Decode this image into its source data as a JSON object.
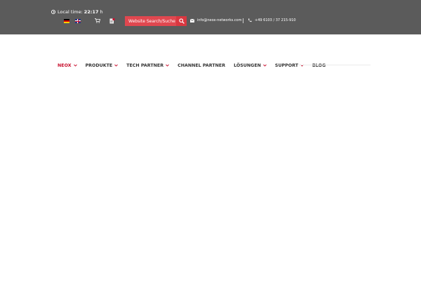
{
  "topbar": {
    "local_time_label": "Local time:",
    "local_time_value": "22:17",
    "local_time_unit": "h",
    "clock_icon": "clock-icon",
    "languages": [
      {
        "code": "de",
        "icon": "german-flag-icon"
      },
      {
        "code": "en",
        "icon": "uk-flag-icon"
      }
    ],
    "cart_icon": "cart-icon",
    "document_icon": "pdf-document-icon",
    "search": {
      "placeholder": "Website Search/Suche",
      "button_icon": "search-icon"
    },
    "email": "info@neox-networks.com",
    "phone": "+49 6103 / 37 215-910"
  },
  "nav": {
    "items": [
      {
        "label": "NEOX",
        "has_dropdown": true,
        "active": true
      },
      {
        "label": "PRODUKTE",
        "has_dropdown": true,
        "active": false
      },
      {
        "label": "TECH PARTNER",
        "has_dropdown": true,
        "active": false
      },
      {
        "label": "CHANNEL PARTNER",
        "has_dropdown": false,
        "active": false
      },
      {
        "label": "LÖSUNGEN",
        "has_dropdown": true,
        "active": false
      },
      {
        "label": "SUPPORT",
        "has_dropdown": true,
        "active": false
      },
      {
        "label": "BLOG",
        "has_dropdown": false,
        "active": false
      }
    ]
  },
  "colors": {
    "topbar_bg": "#5b5b5b",
    "search_bg": "#e0474f",
    "accent": "#c8102e"
  }
}
